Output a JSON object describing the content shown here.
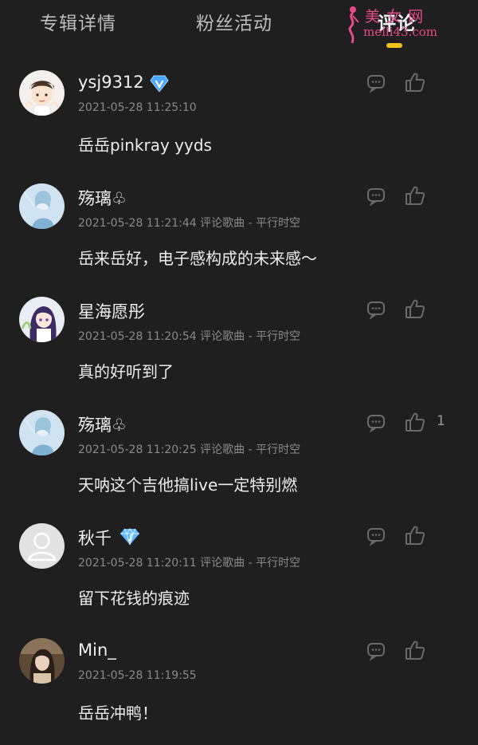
{
  "tabs": [
    {
      "label": "专辑详情"
    },
    {
      "label": "粉丝活动"
    },
    {
      "label": "评论"
    }
  ],
  "active_tab": "评论",
  "accent_color": "#f1c21b",
  "watermark": {
    "line1": "美 女 网",
    "line2": "meili43.com"
  },
  "comments": [
    {
      "user": "ysj9312",
      "badge": "v-verified-icon",
      "time": "2021-05-28 11:25:10",
      "meta": "2021-05-28 11:25:10",
      "text": "岳岳pinkray yyds",
      "likes": "",
      "avatar": "cartoon-boy"
    },
    {
      "user": "殇璃♧",
      "badge": "",
      "time": "2021-05-28 11:21:44",
      "meta": "2021-05-28 11:21:44 评论歌曲 - 平行时空",
      "text": "岳来岳好，电子感构成的未来感～",
      "likes": "",
      "avatar": "anime-blue"
    },
    {
      "user": "星海愿彤",
      "badge": "",
      "time": "2021-05-28 11:20:54",
      "meta": "2021-05-28 11:20:54 评论歌曲 - 平行时空",
      "text": "真的好听到了",
      "likes": "",
      "avatar": "anime-purple"
    },
    {
      "user": "殇璃♧",
      "badge": "",
      "time": "2021-05-28 11:20:25",
      "meta": "2021-05-28 11:20:25 评论歌曲 - 平行时空",
      "text": "天呐这个吉他搞live一定特别燃",
      "likes": "1",
      "avatar": "anime-blue"
    },
    {
      "user": "秋千",
      "badge": "diamond-icon",
      "time": "2021-05-28 11:20:11",
      "meta": "2021-05-28 11:20:11 评论歌曲 - 平行时空",
      "text": "留下花钱的痕迹",
      "likes": "",
      "avatar": "default-person"
    },
    {
      "user": "Min_",
      "badge": "",
      "time": "2021-05-28 11:19:55",
      "meta": "2021-05-28 11:19:55",
      "text": "岳岳冲鸭！",
      "likes": "",
      "avatar": "photo-girl"
    }
  ]
}
